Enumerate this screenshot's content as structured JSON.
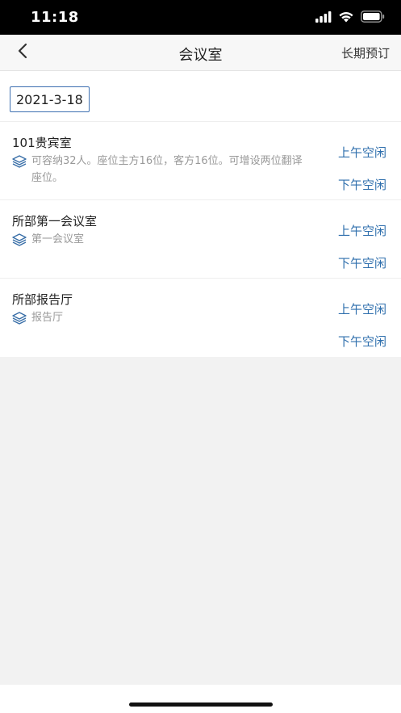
{
  "status_bar": {
    "time": "11:18"
  },
  "nav": {
    "title": "会议室",
    "right_action": "长期预订"
  },
  "date": "2021-3-18",
  "rooms": [
    {
      "name": "101贵宾室",
      "description": "可容纳32人。座位主方16位，客方16位。可增设两位翻译座位。",
      "am_status": "上午空闲",
      "pm_status": "下午空闲"
    },
    {
      "name": "所部第一会议室",
      "description": "第一会议室",
      "am_status": "上午空闲",
      "pm_status": "下午空闲"
    },
    {
      "name": "所部报告厅",
      "description": "报告厅",
      "am_status": "上午空闲",
      "pm_status": "下午空闲"
    }
  ],
  "colors": {
    "accent": "#2f6fad",
    "secondary_text": "#999999",
    "status_bar_bg": "#000000"
  },
  "icons": {
    "back": "chevron-left-icon",
    "room": "layers-icon",
    "signal": "signal-icon",
    "wifi": "wifi-icon",
    "battery": "battery-icon"
  }
}
